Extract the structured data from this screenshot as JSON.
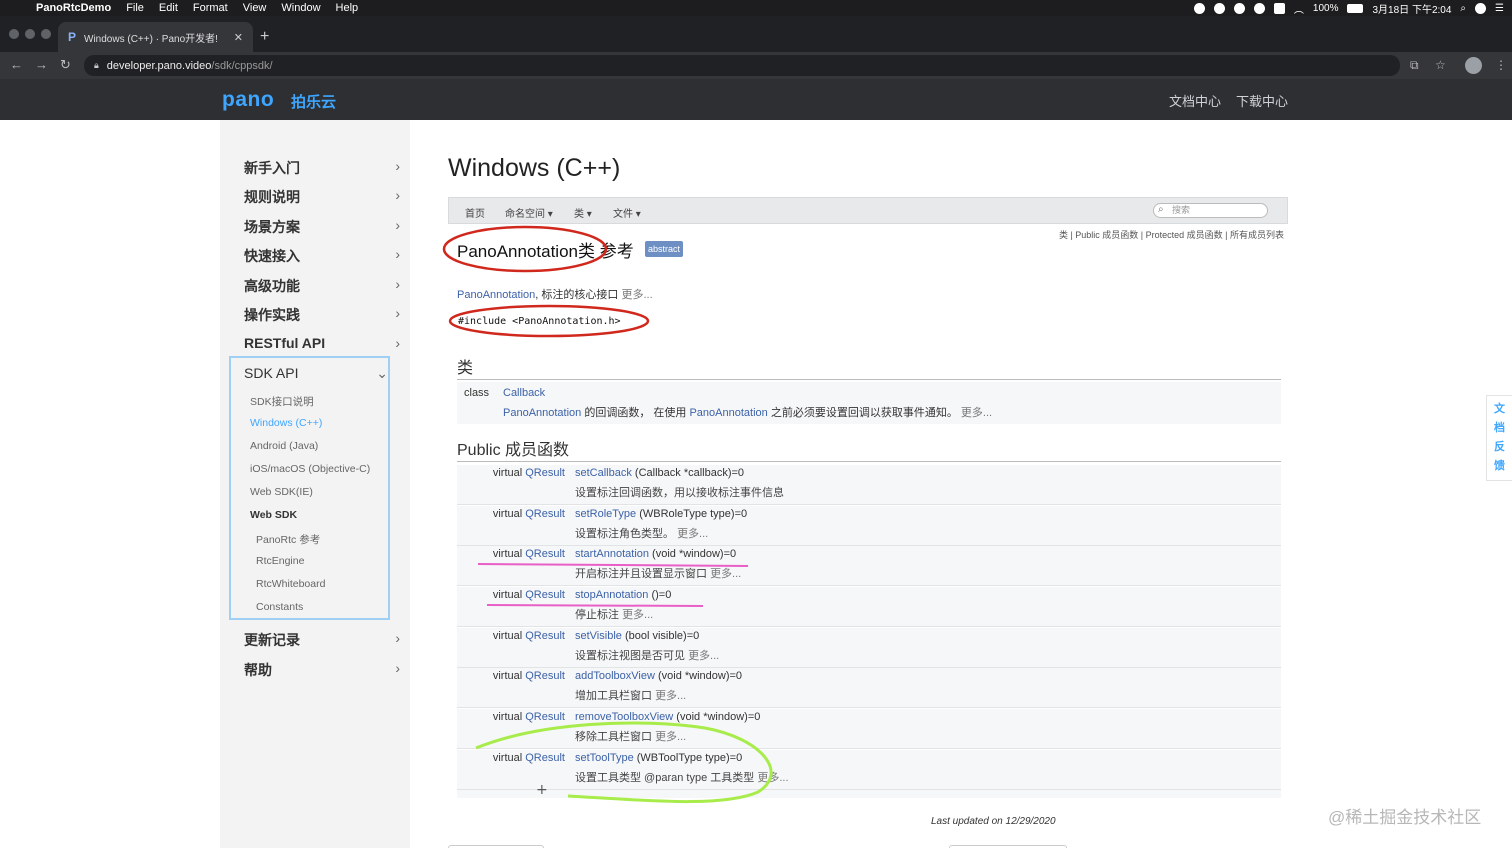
{
  "menubar": {
    "app": "PanoRtcDemo",
    "items": [
      "File",
      "Edit",
      "Format",
      "View",
      "Window",
      "Help"
    ],
    "battery": "100%",
    "datetime": "3月18日 下午2:04"
  },
  "browser": {
    "tab_title": "Windows (C++) · Pano开发者!",
    "url_host": "developer.pano.video",
    "url_path": "/sdk/cppsdk/"
  },
  "site": {
    "logo": "pano",
    "logo_cn": "拍乐云",
    "nav": [
      "文档中心",
      "下载中心"
    ]
  },
  "sidebar": {
    "items": [
      "新手入门",
      "规则说明",
      "场景方案",
      "快速接入",
      "高级功能",
      "操作实践",
      "RESTful API"
    ],
    "sdk_api": {
      "label": "SDK API",
      "subitems": [
        "SDK接口说明",
        "Windows (C++)",
        "Android (Java)",
        "iOS/macOS (Objective-C)",
        "Web SDK(IE)",
        "Web SDK"
      ],
      "web_sdk_children": [
        "PanoRtc 参考",
        "RtcEngine",
        "RtcWhiteboard",
        "Constants"
      ]
    },
    "bottom_items": [
      "更新记录",
      "帮助"
    ]
  },
  "page": {
    "title": "Windows (C++)",
    "docnav": [
      "首页",
      "命名空间",
      "类",
      "文件"
    ],
    "search_placeholder": "搜索",
    "summary_links": "类 | Public 成员函数 | Protected 成员函数 | 所有成员列表",
    "class_name": "PanoAnnotation类",
    "class_suffix": "参考",
    "badge": "abstract",
    "brief_link": "PanoAnnotation",
    "brief_text": ", 标注的核心接口",
    "more": "更多...",
    "include": "#include <PanoAnnotation.h>",
    "classes_header": "类",
    "class_entry": {
      "keyword": "class",
      "name": "Callback",
      "desc_link1": "PanoAnnotation",
      "desc_mid": " 的回调函数， 在使用 ",
      "desc_link2": "PanoAnnotation",
      "desc_end": " 之前必须要设置回调以获取事件通知。"
    },
    "public_header": "Public 成员函数",
    "members": [
      {
        "ret_kw": "virtual",
        "ret_type": "QResult",
        "name": "setCallback",
        "params": " (Callback *callback)=0",
        "desc": "设置标注回调函数，用以接收标注事件信息",
        "more": ""
      },
      {
        "ret_kw": "virtual",
        "ret_type": "QResult",
        "name": "setRoleType",
        "params": " (WBRoleType type)=0",
        "desc": "设置标注角色类型。",
        "more": "更多..."
      },
      {
        "ret_kw": "virtual",
        "ret_type": "QResult",
        "name": "startAnnotation",
        "params": " (void *window)=0",
        "desc": "开启标注并且设置显示窗口",
        "more": "更多..."
      },
      {
        "ret_kw": "virtual",
        "ret_type": "QResult",
        "name": "stopAnnotation",
        "params": " ()=0",
        "desc": "停止标注",
        "more": "更多..."
      },
      {
        "ret_kw": "virtual",
        "ret_type": "QResult",
        "name": "setVisible",
        "params": " (bool visible)=0",
        "desc": "设置标注视图是否可见",
        "more": "更多..."
      },
      {
        "ret_kw": "virtual",
        "ret_type": "QResult",
        "name": "addToolboxView",
        "params": " (void *window)=0",
        "desc": "增加工具栏窗口",
        "more": "更多..."
      },
      {
        "ret_kw": "virtual",
        "ret_type": "QResult",
        "name": "removeToolboxView",
        "params": " (void *window)=0",
        "desc": "移除工具栏窗口",
        "more": "更多..."
      },
      {
        "ret_kw": "virtual",
        "ret_type": "QResult",
        "name": "setToolType",
        "params": " (WBToolType type)=0",
        "desc": "设置工具类型 @paran type 工具类型",
        "more": "更多..."
      }
    ],
    "last_updated": "Last updated on 12/29/2020"
  },
  "feedback": [
    "文",
    "档",
    "反",
    "馈"
  ],
  "watermark": "@稀土掘金技术社区",
  "colors": {
    "accent": "#3ea6ff",
    "link": "#3c62a8",
    "circle_red": "#d0281c",
    "underline_pink": "#e85fc8",
    "scribble_green": "#a8ec4c"
  }
}
